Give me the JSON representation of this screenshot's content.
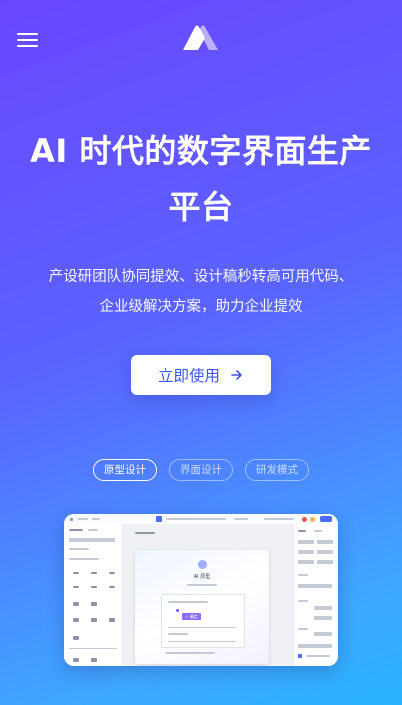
{
  "header": {
    "menu_icon": "hamburger-menu-icon",
    "logo_icon": "brand-logo-icon"
  },
  "hero": {
    "title": "AI 时代的数字界面生产平台",
    "subtitle": "产设研团队协同提效、设计稿秒转高可用代码、企业级解决方案，助力企业提效",
    "cta_label": "立即使用",
    "cta_icon": "arrow-right-icon"
  },
  "tabs": [
    {
      "label": "原型设计",
      "active": true
    },
    {
      "label": "界面设计",
      "active": false
    },
    {
      "label": "研发模式",
      "active": false
    }
  ],
  "preview": {
    "frame_title": "AI 原型",
    "button_label": "✓ 确定"
  },
  "colors": {
    "gradient_start": "#6a47ff",
    "gradient_end": "#2ab4ff",
    "cta_text": "#3f57e8",
    "accent_purple": "#8b6cf0"
  }
}
